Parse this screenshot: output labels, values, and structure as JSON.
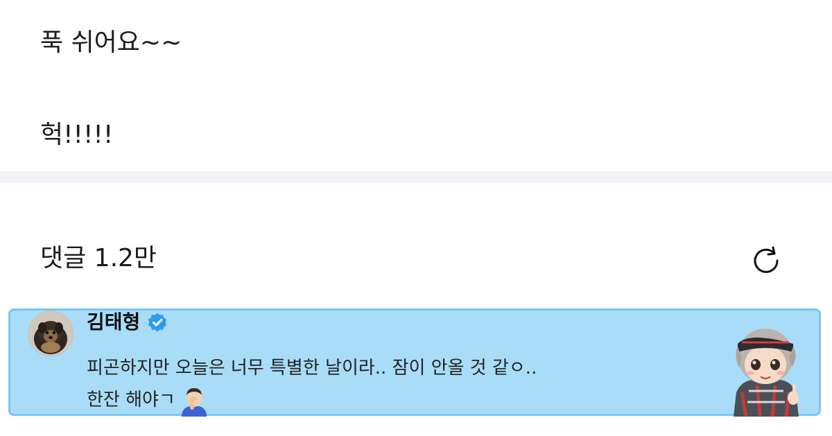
{
  "post": {
    "lines": [
      "푹 쉬어요~~",
      "헉!!!!!"
    ]
  },
  "comments": {
    "header": "댓글 1.2만",
    "refresh_icon": "refresh-icon"
  },
  "highlighted_comment": {
    "author": "김태형",
    "verified": true,
    "line1": "피곤하지만 오늘은 너무 특별한 날이라.. 잠이 안올 것 같ㅇ..",
    "line2": "한잔 해야ㄱ",
    "colors": {
      "background": "#a9dcf7",
      "border": "#7cc5ef",
      "verified_badge": "#2f9bf0"
    },
    "icons": [
      "avatar-dog-photo",
      "verified-badge-icon",
      "facepalm-emoji-icon",
      "character-sticker"
    ]
  }
}
